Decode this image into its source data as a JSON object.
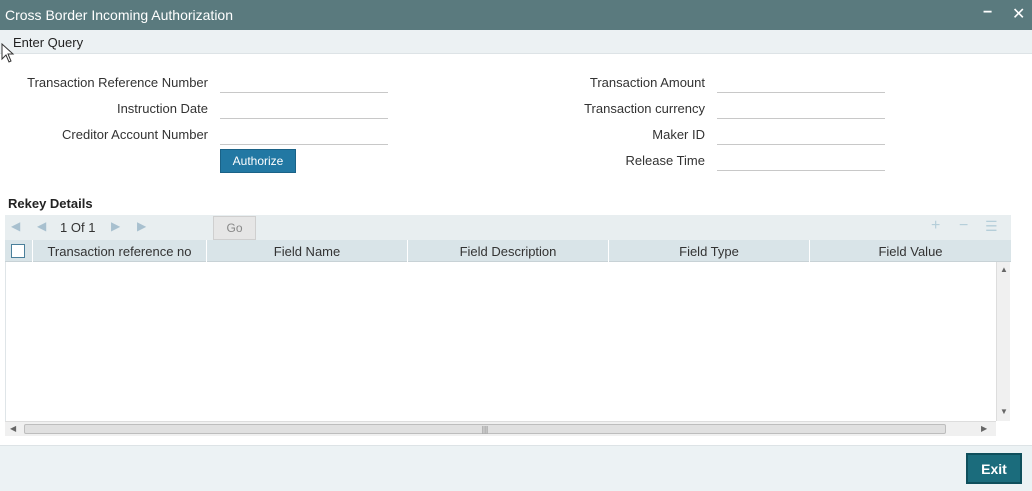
{
  "window": {
    "title": "Cross Border Incoming Authorization",
    "minimize_glyph": "−",
    "close_glyph": "✕"
  },
  "toolbar": {
    "enter_query": "Enter Query"
  },
  "form": {
    "transaction_reference_number": {
      "label": "Transaction Reference Number",
      "value": ""
    },
    "instruction_date": {
      "label": "Instruction Date",
      "value": ""
    },
    "creditor_account_number": {
      "label": "Creditor Account Number",
      "value": ""
    },
    "transaction_amount": {
      "label": "Transaction Amount",
      "value": ""
    },
    "transaction_currency": {
      "label": "Transaction currency",
      "value": ""
    },
    "maker_id": {
      "label": "Maker ID",
      "value": ""
    },
    "release_time": {
      "label": "Release Time",
      "value": ""
    },
    "authorize_label": "Authorize"
  },
  "rekey": {
    "title": "Rekey Details",
    "pagination": {
      "current": "1",
      "of_label": "Of",
      "total": "1"
    },
    "go_label": "Go",
    "columns": [
      "Transaction reference no",
      "Field Name",
      "Field Description",
      "Field Type",
      "Field Value"
    ],
    "rows": []
  },
  "footer": {
    "exit_label": "Exit"
  },
  "colors": {
    "titlebar": "#5a7a7e",
    "primary_button": "#2278a3",
    "exit_button": "#1b6c7c",
    "grid_header": "#d9e4e8"
  }
}
